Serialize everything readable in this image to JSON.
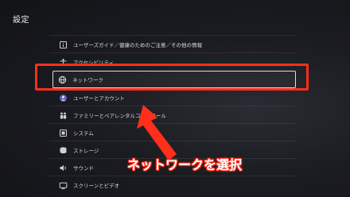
{
  "header": {
    "title": "設定"
  },
  "menu": {
    "items": [
      {
        "label": "ユーザーズガイド／健康のためのご注意／その他の情報",
        "icon": "info-book-icon"
      },
      {
        "label": "アクセシビリティ",
        "icon": "accessibility-icon"
      },
      {
        "label": "ネットワーク",
        "icon": "globe-icon"
      },
      {
        "label": "ユーザーとアカウント",
        "icon": "user-icon"
      },
      {
        "label": "ファミリーとペアレンタルコントロール",
        "icon": "family-icon"
      },
      {
        "label": "システム",
        "icon": "system-icon"
      },
      {
        "label": "ストレージ",
        "icon": "storage-icon"
      },
      {
        "label": "サウンド",
        "icon": "speaker-icon"
      },
      {
        "label": "スクリーンとビデオ",
        "icon": "screen-icon"
      }
    ],
    "selected_index": 2
  },
  "annotation": {
    "callout_text": "ネットワークを選択",
    "accent_color": "#ff2f1c"
  }
}
